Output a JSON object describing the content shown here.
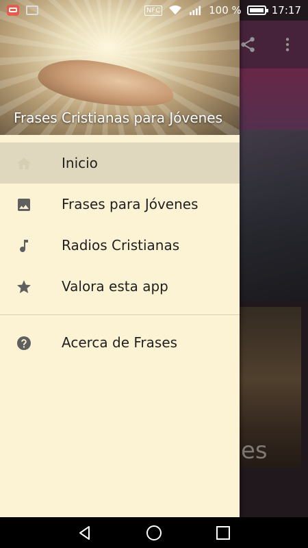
{
  "status_bar": {
    "nfc_label": "NFC",
    "battery_percent": "100 %",
    "time": "17:17"
  },
  "drawer": {
    "header_title": "Frases Cristianas para Jóvenes",
    "items": [
      {
        "label": "Inicio",
        "icon": "home-icon",
        "active": true
      },
      {
        "label": "Frases para Jóvenes",
        "icon": "image-icon",
        "active": false
      },
      {
        "label": "Radios Cristianas",
        "icon": "music-note-icon",
        "active": false
      },
      {
        "label": "Valora esta app",
        "icon": "star-icon",
        "active": false
      }
    ],
    "secondary_items": [
      {
        "label": "Acerca de Frases",
        "icon": "help-icon"
      }
    ]
  },
  "background_app": {
    "card_text": "es",
    "toolbar_color": "#7b3d66"
  },
  "colors": {
    "drawer_bg": "#fcf3d4",
    "active_item_bg": "#e0d8be",
    "icon_gray": "#5f5f5f"
  }
}
